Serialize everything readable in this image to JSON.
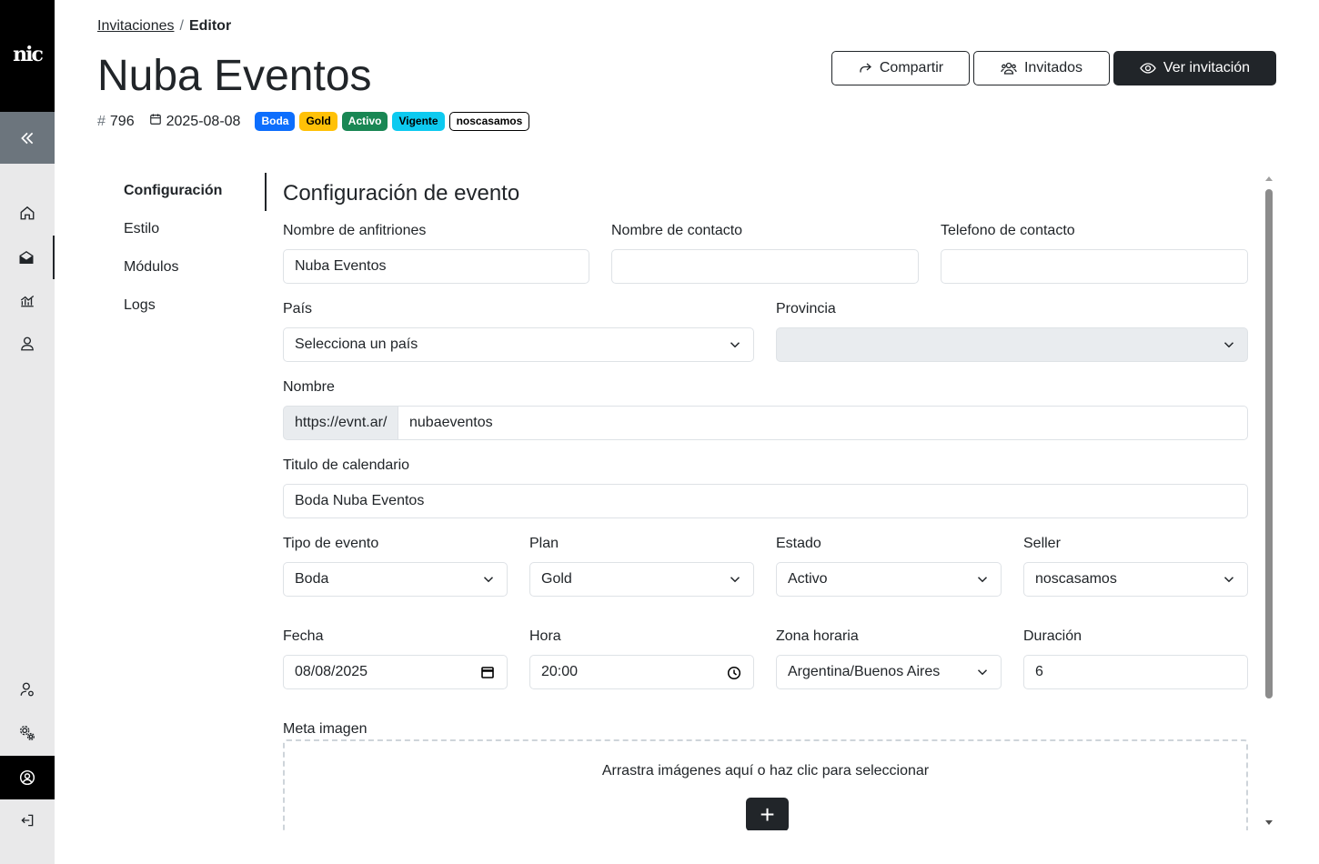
{
  "sidebar": {
    "logo": "nic",
    "collapse_icon": "double-chevron-left-icon",
    "nav_icons": [
      "home-icon",
      "mail-open-icon",
      "chart-icon",
      "user-icon"
    ],
    "bottom_icons": [
      "user-settings-icon",
      "gears-icon",
      "profile-circle-icon",
      "logout-icon"
    ]
  },
  "breadcrumb": {
    "parent": "Invitaciones",
    "separator": "/",
    "current": "Editor"
  },
  "header": {
    "title": "Nuba Eventos",
    "id_prefix": "#",
    "id": "796",
    "date": "2025-08-08",
    "badges": {
      "type": "Boda",
      "plan": "Gold",
      "status": "Activo",
      "validity": "Vigente",
      "seller": "noscasamos"
    },
    "badge_colors": {
      "Boda": "#0d6efd",
      "Gold": "#ffc107",
      "Activo": "#198754",
      "Vigente": "#0dcaf0"
    }
  },
  "actions": {
    "share": "Compartir",
    "guests": "Invitados",
    "view": "Ver invitación"
  },
  "subnav": {
    "config": "Configuración",
    "style": "Estilo",
    "modules": "Módulos",
    "logs": "Logs"
  },
  "form": {
    "section_title": "Configuración de evento",
    "hosts_label": "Nombre de anfitriones",
    "hosts_value": "Nuba Eventos",
    "contact_name_label": "Nombre de contacto",
    "contact_name_value": "",
    "contact_phone_label": "Telefono de contacto",
    "contact_phone_value": "",
    "country_label": "País",
    "country_value": "Selecciona un país",
    "province_label": "Provincia",
    "province_value": "",
    "name_label": "Nombre",
    "name_prefix": "https://evnt.ar/",
    "name_value": "nubaeventos",
    "calendar_label": "Titulo de calendario",
    "calendar_value": "Boda Nuba Eventos",
    "event_type_label": "Tipo de evento",
    "event_type_value": "Boda",
    "plan_label": "Plan",
    "plan_value": "Gold",
    "status_label": "Estado",
    "status_value": "Activo",
    "seller_label": "Seller",
    "seller_value": "noscasamos",
    "date_label": "Fecha",
    "date_value": "08/08/2025",
    "time_label": "Hora",
    "time_value": "20:00",
    "tz_label": "Zona horaria",
    "tz_value": "Argentina/Buenos Aires",
    "duration_label": "Duración",
    "duration_value": "6",
    "meta_image_label": "Meta imagen",
    "dropzone_text": "Arrastra imágenes aquí o haz clic para seleccionar",
    "dropzone_button": "+"
  }
}
